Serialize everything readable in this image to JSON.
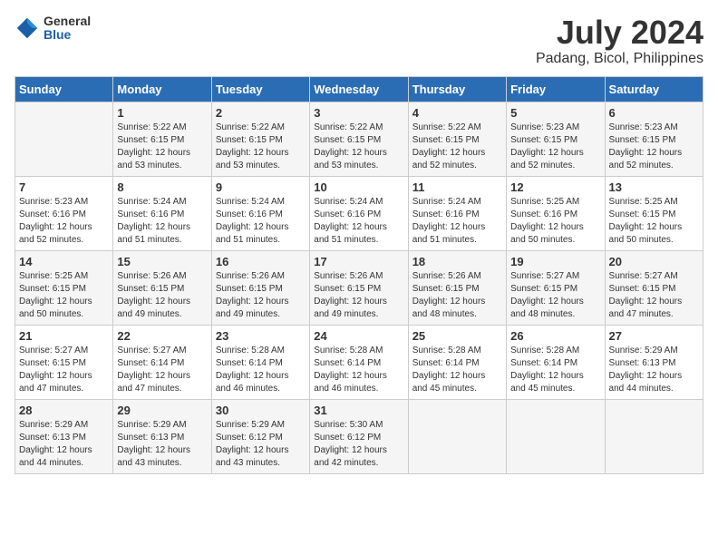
{
  "header": {
    "logo_general": "General",
    "logo_blue": "Blue",
    "month": "July 2024",
    "location": "Padang, Bicol, Philippines"
  },
  "days_of_week": [
    "Sunday",
    "Monday",
    "Tuesday",
    "Wednesday",
    "Thursday",
    "Friday",
    "Saturday"
  ],
  "weeks": [
    [
      {
        "day": "",
        "info": ""
      },
      {
        "day": "1",
        "info": "Sunrise: 5:22 AM\nSunset: 6:15 PM\nDaylight: 12 hours\nand 53 minutes."
      },
      {
        "day": "2",
        "info": "Sunrise: 5:22 AM\nSunset: 6:15 PM\nDaylight: 12 hours\nand 53 minutes."
      },
      {
        "day": "3",
        "info": "Sunrise: 5:22 AM\nSunset: 6:15 PM\nDaylight: 12 hours\nand 53 minutes."
      },
      {
        "day": "4",
        "info": "Sunrise: 5:22 AM\nSunset: 6:15 PM\nDaylight: 12 hours\nand 52 minutes."
      },
      {
        "day": "5",
        "info": "Sunrise: 5:23 AM\nSunset: 6:15 PM\nDaylight: 12 hours\nand 52 minutes."
      },
      {
        "day": "6",
        "info": "Sunrise: 5:23 AM\nSunset: 6:15 PM\nDaylight: 12 hours\nand 52 minutes."
      }
    ],
    [
      {
        "day": "7",
        "info": "Sunrise: 5:23 AM\nSunset: 6:16 PM\nDaylight: 12 hours\nand 52 minutes."
      },
      {
        "day": "8",
        "info": "Sunrise: 5:24 AM\nSunset: 6:16 PM\nDaylight: 12 hours\nand 51 minutes."
      },
      {
        "day": "9",
        "info": "Sunrise: 5:24 AM\nSunset: 6:16 PM\nDaylight: 12 hours\nand 51 minutes."
      },
      {
        "day": "10",
        "info": "Sunrise: 5:24 AM\nSunset: 6:16 PM\nDaylight: 12 hours\nand 51 minutes."
      },
      {
        "day": "11",
        "info": "Sunrise: 5:24 AM\nSunset: 6:16 PM\nDaylight: 12 hours\nand 51 minutes."
      },
      {
        "day": "12",
        "info": "Sunrise: 5:25 AM\nSunset: 6:16 PM\nDaylight: 12 hours\nand 50 minutes."
      },
      {
        "day": "13",
        "info": "Sunrise: 5:25 AM\nSunset: 6:15 PM\nDaylight: 12 hours\nand 50 minutes."
      }
    ],
    [
      {
        "day": "14",
        "info": "Sunrise: 5:25 AM\nSunset: 6:15 PM\nDaylight: 12 hours\nand 50 minutes."
      },
      {
        "day": "15",
        "info": "Sunrise: 5:26 AM\nSunset: 6:15 PM\nDaylight: 12 hours\nand 49 minutes."
      },
      {
        "day": "16",
        "info": "Sunrise: 5:26 AM\nSunset: 6:15 PM\nDaylight: 12 hours\nand 49 minutes."
      },
      {
        "day": "17",
        "info": "Sunrise: 5:26 AM\nSunset: 6:15 PM\nDaylight: 12 hours\nand 49 minutes."
      },
      {
        "day": "18",
        "info": "Sunrise: 5:26 AM\nSunset: 6:15 PM\nDaylight: 12 hours\nand 48 minutes."
      },
      {
        "day": "19",
        "info": "Sunrise: 5:27 AM\nSunset: 6:15 PM\nDaylight: 12 hours\nand 48 minutes."
      },
      {
        "day": "20",
        "info": "Sunrise: 5:27 AM\nSunset: 6:15 PM\nDaylight: 12 hours\nand 47 minutes."
      }
    ],
    [
      {
        "day": "21",
        "info": "Sunrise: 5:27 AM\nSunset: 6:15 PM\nDaylight: 12 hours\nand 47 minutes."
      },
      {
        "day": "22",
        "info": "Sunrise: 5:27 AM\nSunset: 6:14 PM\nDaylight: 12 hours\nand 47 minutes."
      },
      {
        "day": "23",
        "info": "Sunrise: 5:28 AM\nSunset: 6:14 PM\nDaylight: 12 hours\nand 46 minutes."
      },
      {
        "day": "24",
        "info": "Sunrise: 5:28 AM\nSunset: 6:14 PM\nDaylight: 12 hours\nand 46 minutes."
      },
      {
        "day": "25",
        "info": "Sunrise: 5:28 AM\nSunset: 6:14 PM\nDaylight: 12 hours\nand 45 minutes."
      },
      {
        "day": "26",
        "info": "Sunrise: 5:28 AM\nSunset: 6:14 PM\nDaylight: 12 hours\nand 45 minutes."
      },
      {
        "day": "27",
        "info": "Sunrise: 5:29 AM\nSunset: 6:13 PM\nDaylight: 12 hours\nand 44 minutes."
      }
    ],
    [
      {
        "day": "28",
        "info": "Sunrise: 5:29 AM\nSunset: 6:13 PM\nDaylight: 12 hours\nand 44 minutes."
      },
      {
        "day": "29",
        "info": "Sunrise: 5:29 AM\nSunset: 6:13 PM\nDaylight: 12 hours\nand 43 minutes."
      },
      {
        "day": "30",
        "info": "Sunrise: 5:29 AM\nSunset: 6:12 PM\nDaylight: 12 hours\nand 43 minutes."
      },
      {
        "day": "31",
        "info": "Sunrise: 5:30 AM\nSunset: 6:12 PM\nDaylight: 12 hours\nand 42 minutes."
      },
      {
        "day": "",
        "info": ""
      },
      {
        "day": "",
        "info": ""
      },
      {
        "day": "",
        "info": ""
      }
    ]
  ]
}
